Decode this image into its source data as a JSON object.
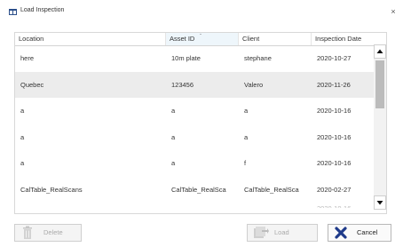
{
  "window": {
    "title": "Load Inspection",
    "icon": "app-window-icon",
    "close_glyph": "×"
  },
  "table": {
    "columns": [
      "Location",
      "Asset ID",
      "Client",
      "Inspection Date"
    ],
    "sorted_column": "Asset ID",
    "rows": [
      {
        "location": "here",
        "asset_id": "10m plate",
        "client": "stephane",
        "date": "2020-10-27",
        "selected": false
      },
      {
        "location": "Quebec",
        "asset_id": "123456",
        "client": "Valero",
        "date": "2020-11-26",
        "selected": true
      },
      {
        "location": "a",
        "asset_id": "a",
        "client": "a",
        "date": "2020-10-16",
        "selected": false
      },
      {
        "location": "a",
        "asset_id": "a",
        "client": "a",
        "date": "2020-10-16",
        "selected": false
      },
      {
        "location": "a",
        "asset_id": "a",
        "client": "f",
        "date": "2020-10-16",
        "selected": false
      },
      {
        "location": "CalTable_RealScans",
        "asset_id": "CalTable_RealSca",
        "client": "CalTable_RealSca",
        "date": "2020-02-27",
        "selected": false
      }
    ]
  },
  "buttons": {
    "delete": {
      "label": "Delete",
      "icon": "trash-icon",
      "enabled": false
    },
    "load": {
      "label": "Load",
      "icon": "load-icon",
      "enabled": false
    },
    "cancel": {
      "label": "Cancel",
      "icon": "cancel-x-icon",
      "enabled": true
    }
  },
  "colors": {
    "selected_row": "#ececec",
    "sorted_header": "#eef6fb",
    "cancel_x": "#1f3a8a"
  }
}
